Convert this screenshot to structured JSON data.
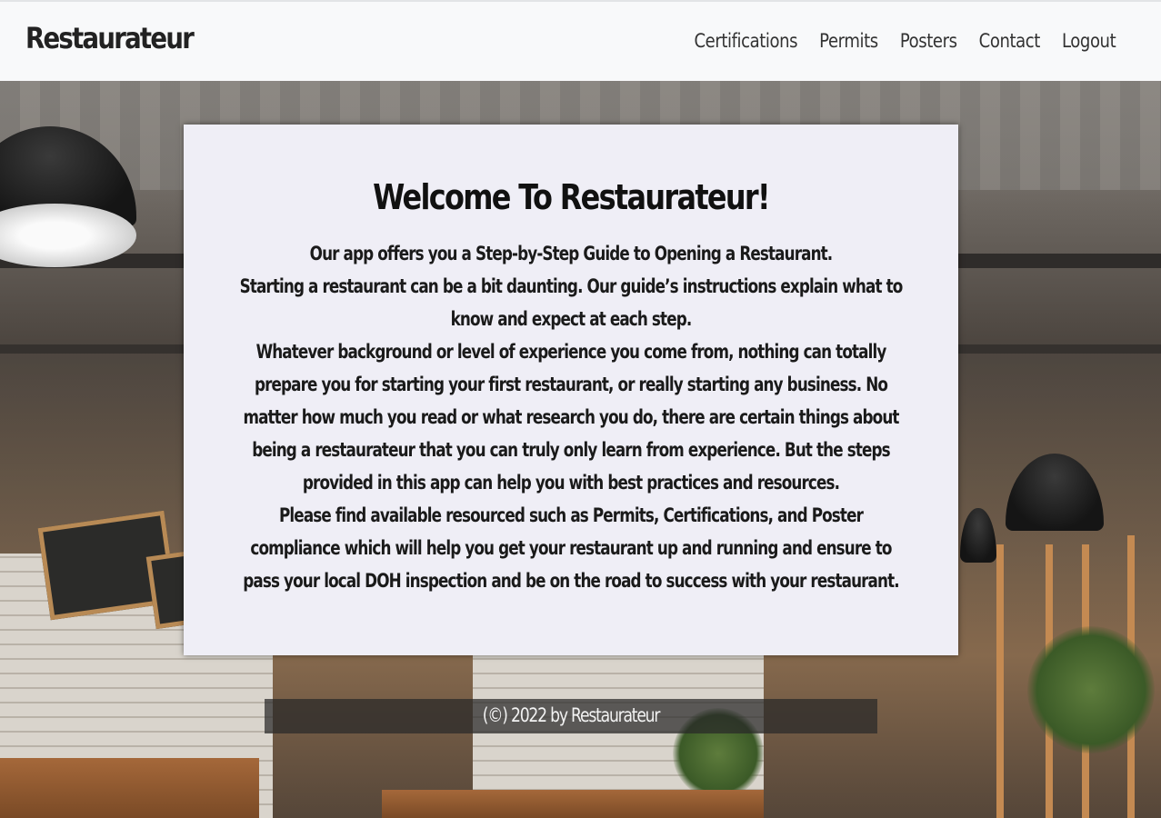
{
  "navbar": {
    "brand": "Restaurateur",
    "links": [
      "Certifications",
      "Permits",
      "Posters",
      "Contact",
      "Logout"
    ]
  },
  "welcome": {
    "title": "Welcome To Restaurateur!",
    "paragraphs": [
      "Our app offers you a Step-by-Step Guide to Opening a Restaurant.",
      "Starting a restaurant can be a bit daunting. Our guide’s instructions explain what to know and expect at each step.",
      "Whatever background or level of experience you come from, nothing can totally prepare you for starting your first restaurant, or really starting any business. No matter how much you read or what research you do, there are certain things about being a restaurateur that you can truly only learn from experience. But the steps provided in this app can help you with best practices and resources.",
      "Please find available resourced such as Permits, Certifications, and Poster compliance which will help you get your restaurant up and running and ensure to pass your local DOH inspection and be on the road to success with your restaurant."
    ]
  },
  "footer": {
    "text": "(©) 2022 by Restaurateur"
  },
  "colors": {
    "navbar_bg": "#f8f9fa",
    "card_bg": "#efeef6",
    "footer_bg": "#282828"
  }
}
